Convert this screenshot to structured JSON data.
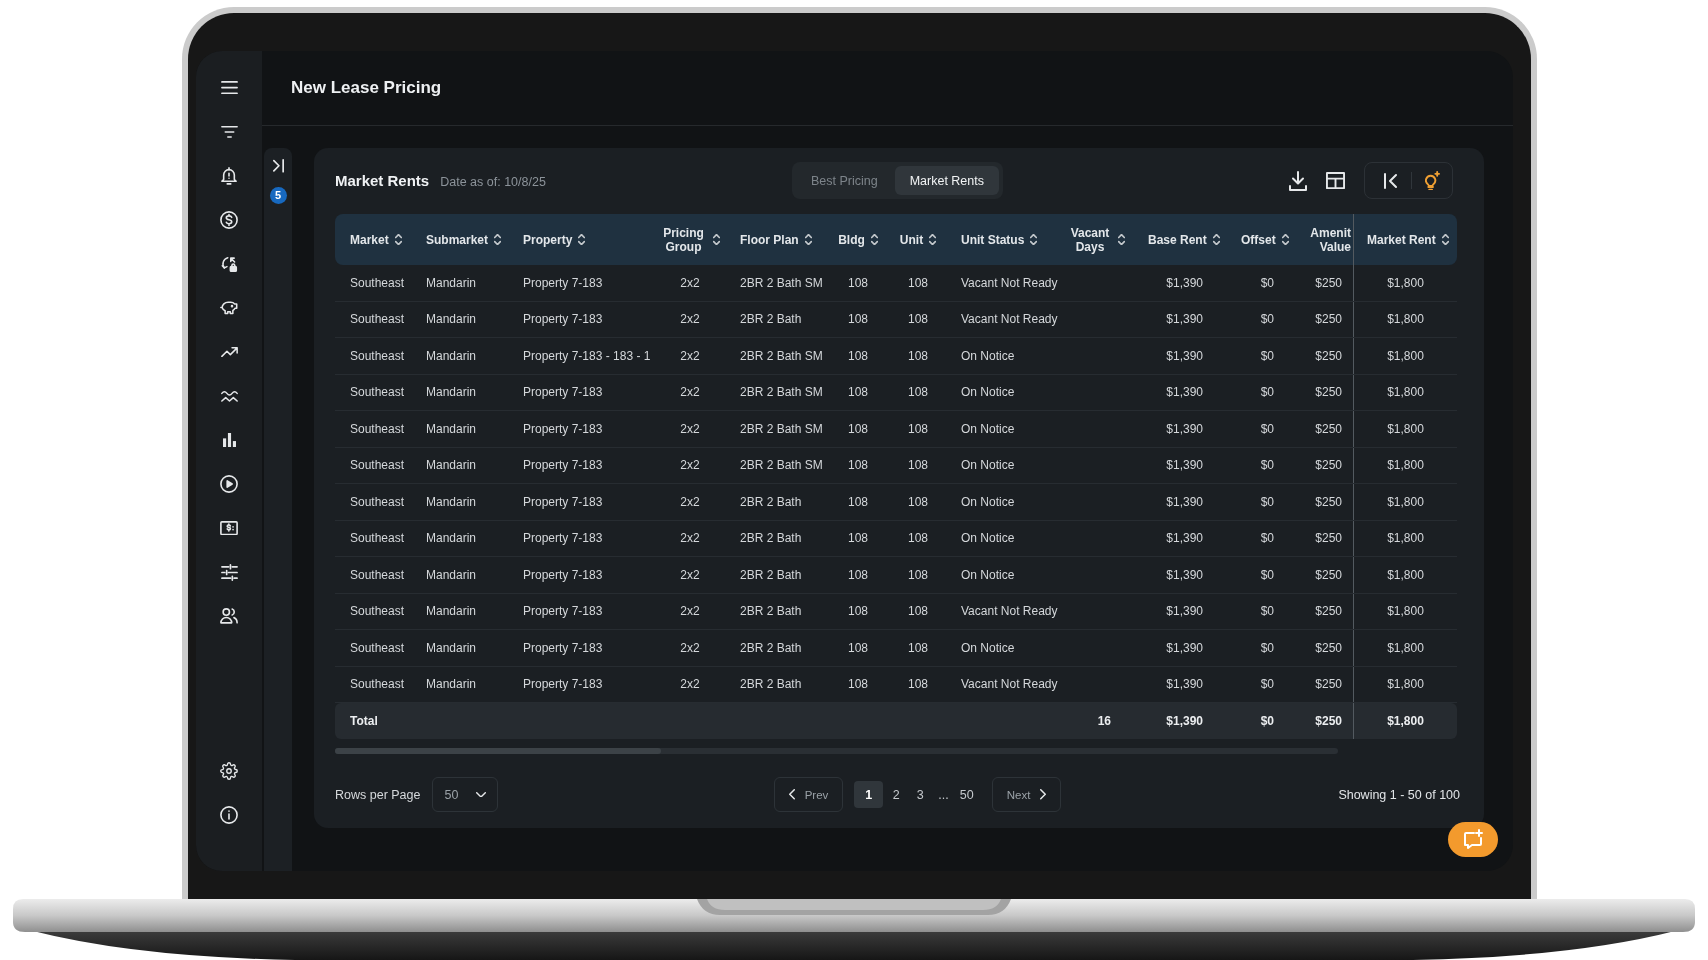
{
  "header": {
    "title": "New Lease Pricing"
  },
  "side_panel": {
    "badge": "5"
  },
  "card": {
    "title": "Market Rents",
    "date_note": "Date as of: 10/8/25",
    "view_tabs": [
      {
        "label": "Best Pricing",
        "selected": false
      },
      {
        "label": "Market Rents",
        "selected": true
      }
    ]
  },
  "table": {
    "columns": [
      "Market",
      "Submarket",
      "Property",
      "Pricing Group",
      "Floor Plan",
      "Bldg",
      "Unit",
      "Unit Status",
      "Vacant Days",
      "Base Rent",
      "Offset",
      "Amenit Value",
      "Market Rent"
    ],
    "rows": [
      {
        "market": "Southeast",
        "submarket": "Mandarin",
        "property": "Property 7-183",
        "pricing_group": "2x2",
        "floor_plan": "2BR 2 Bath SM",
        "bldg": "108",
        "unit": "108",
        "unit_status": "Vacant Not Ready",
        "base_rent": "$1,390",
        "offset": "$0",
        "amenity_value": "$250",
        "market_rent": "$1,800"
      },
      {
        "market": "Southeast",
        "submarket": "Mandarin",
        "property": "Property 7-183",
        "pricing_group": "2x2",
        "floor_plan": "2BR 2 Bath",
        "bldg": "108",
        "unit": "108",
        "unit_status": "Vacant Not Ready",
        "base_rent": "$1,390",
        "offset": "$0",
        "amenity_value": "$250",
        "market_rent": "$1,800"
      },
      {
        "market": "Southeast",
        "submarket": "Mandarin",
        "property": "Property 7-183 - 183 - 1",
        "pricing_group": "2x2",
        "floor_plan": "2BR 2 Bath SM",
        "bldg": "108",
        "unit": "108",
        "unit_status": "On Notice",
        "base_rent": "$1,390",
        "offset": "$0",
        "amenity_value": "$250",
        "market_rent": "$1,800"
      },
      {
        "market": "Southeast",
        "submarket": "Mandarin",
        "property": "Property 7-183",
        "pricing_group": "2x2",
        "floor_plan": "2BR 2 Bath SM",
        "bldg": "108",
        "unit": "108",
        "unit_status": "On Notice",
        "base_rent": "$1,390",
        "offset": "$0",
        "amenity_value": "$250",
        "market_rent": "$1,800"
      },
      {
        "market": "Southeast",
        "submarket": "Mandarin",
        "property": "Property 7-183",
        "pricing_group": "2x2",
        "floor_plan": "2BR 2 Bath SM",
        "bldg": "108",
        "unit": "108",
        "unit_status": "On Notice",
        "base_rent": "$1,390",
        "offset": "$0",
        "amenity_value": "$250",
        "market_rent": "$1,800"
      },
      {
        "market": "Southeast",
        "submarket": "Mandarin",
        "property": "Property 7-183",
        "pricing_group": "2x2",
        "floor_plan": "2BR 2 Bath SM",
        "bldg": "108",
        "unit": "108",
        "unit_status": "On Notice",
        "base_rent": "$1,390",
        "offset": "$0",
        "amenity_value": "$250",
        "market_rent": "$1,800"
      },
      {
        "market": "Southeast",
        "submarket": "Mandarin",
        "property": "Property 7-183",
        "pricing_group": "2x2",
        "floor_plan": "2BR 2 Bath",
        "bldg": "108",
        "unit": "108",
        "unit_status": "On Notice",
        "base_rent": "$1,390",
        "offset": "$0",
        "amenity_value": "$250",
        "market_rent": "$1,800"
      },
      {
        "market": "Southeast",
        "submarket": "Mandarin",
        "property": "Property 7-183",
        "pricing_group": "2x2",
        "floor_plan": "2BR 2 Bath",
        "bldg": "108",
        "unit": "108",
        "unit_status": "On Notice",
        "base_rent": "$1,390",
        "offset": "$0",
        "amenity_value": "$250",
        "market_rent": "$1,800"
      },
      {
        "market": "Southeast",
        "submarket": "Mandarin",
        "property": "Property 7-183",
        "pricing_group": "2x2",
        "floor_plan": "2BR 2 Bath",
        "bldg": "108",
        "unit": "108",
        "unit_status": "On Notice",
        "base_rent": "$1,390",
        "offset": "$0",
        "amenity_value": "$250",
        "market_rent": "$1,800"
      },
      {
        "market": "Southeast",
        "submarket": "Mandarin",
        "property": "Property 7-183",
        "pricing_group": "2x2",
        "floor_plan": "2BR 2 Bath",
        "bldg": "108",
        "unit": "108",
        "unit_status": "Vacant Not Ready",
        "base_rent": "$1,390",
        "offset": "$0",
        "amenity_value": "$250",
        "market_rent": "$1,800"
      },
      {
        "market": "Southeast",
        "submarket": "Mandarin",
        "property": "Property 7-183",
        "pricing_group": "2x2",
        "floor_plan": "2BR 2 Bath",
        "bldg": "108",
        "unit": "108",
        "unit_status": "On Notice",
        "base_rent": "$1,390",
        "offset": "$0",
        "amenity_value": "$250",
        "market_rent": "$1,800"
      },
      {
        "market": "Southeast",
        "submarket": "Mandarin",
        "property": "Property 7-183",
        "pricing_group": "2x2",
        "floor_plan": "2BR 2 Bath",
        "bldg": "108",
        "unit": "108",
        "unit_status": "Vacant Not Ready",
        "base_rent": "$1,390",
        "offset": "$0",
        "amenity_value": "$250",
        "market_rent": "$1,800"
      }
    ],
    "total": {
      "label": "Total",
      "vacant_days": "16",
      "base_rent": "$1,390",
      "offset": "$0",
      "amenity_value": "$250",
      "market_rent": "$1,800"
    }
  },
  "pagination": {
    "label": "Rows per Page",
    "rows_per_page": "50",
    "prev": "Prev",
    "pages": [
      {
        "kind": "page",
        "label": "1",
        "selected": true
      },
      {
        "kind": "page",
        "label": "2",
        "selected": false
      },
      {
        "kind": "page",
        "label": "3",
        "selected": false
      },
      {
        "kind": "gap",
        "label": "...",
        "selected": false
      },
      {
        "kind": "page",
        "label": "50",
        "selected": false
      }
    ],
    "next": "Next",
    "summary": "Showing 1 - 50 of 100"
  }
}
